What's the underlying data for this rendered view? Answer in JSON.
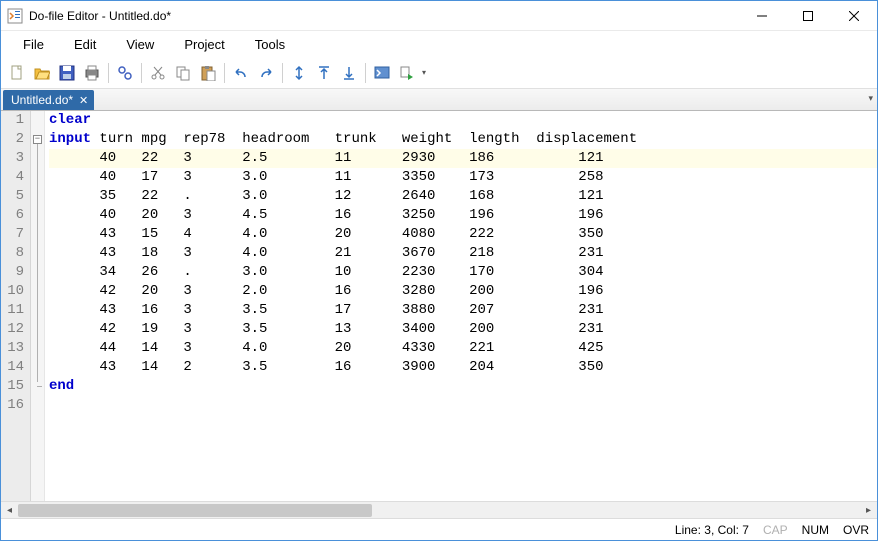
{
  "window": {
    "title": "Do-file Editor - Untitled.do*"
  },
  "menu": {
    "items": [
      "File",
      "Edit",
      "View",
      "Project",
      "Tools"
    ]
  },
  "toolbar": {
    "groups": [
      [
        "new-file",
        "open-file",
        "save",
        "print"
      ],
      [
        "find"
      ],
      [
        "cut",
        "copy",
        "paste"
      ],
      [
        "undo",
        "redo"
      ],
      [
        "indent-toggle",
        "outdent",
        "indent"
      ],
      [
        "run",
        "run-selection"
      ]
    ]
  },
  "tab": {
    "label": "Untitled.do*"
  },
  "code": {
    "keywords": {
      "clear": "clear",
      "input": "input",
      "end": "end"
    },
    "header": "turn mpg  rep78  headroom   trunk   weight  length  displacement",
    "highlight_line": 3,
    "rows": [
      {
        "turn": 40,
        "mpg": 22,
        "rep78": "3",
        "headroom": "2.5",
        "trunk": 11,
        "weight": 2930,
        "length": 186,
        "displacement": 121
      },
      {
        "turn": 40,
        "mpg": 17,
        "rep78": "3",
        "headroom": "3.0",
        "trunk": 11,
        "weight": 3350,
        "length": 173,
        "displacement": 258
      },
      {
        "turn": 35,
        "mpg": 22,
        "rep78": ".",
        "headroom": "3.0",
        "trunk": 12,
        "weight": 2640,
        "length": 168,
        "displacement": 121
      },
      {
        "turn": 40,
        "mpg": 20,
        "rep78": "3",
        "headroom": "4.5",
        "trunk": 16,
        "weight": 3250,
        "length": 196,
        "displacement": 196
      },
      {
        "turn": 43,
        "mpg": 15,
        "rep78": "4",
        "headroom": "4.0",
        "trunk": 20,
        "weight": 4080,
        "length": 222,
        "displacement": 350
      },
      {
        "turn": 43,
        "mpg": 18,
        "rep78": "3",
        "headroom": "4.0",
        "trunk": 21,
        "weight": 3670,
        "length": 218,
        "displacement": 231
      },
      {
        "turn": 34,
        "mpg": 26,
        "rep78": ".",
        "headroom": "3.0",
        "trunk": 10,
        "weight": 2230,
        "length": 170,
        "displacement": 304
      },
      {
        "turn": 42,
        "mpg": 20,
        "rep78": "3",
        "headroom": "2.0",
        "trunk": 16,
        "weight": 3280,
        "length": 200,
        "displacement": 196
      },
      {
        "turn": 43,
        "mpg": 16,
        "rep78": "3",
        "headroom": "3.5",
        "trunk": 17,
        "weight": 3880,
        "length": 207,
        "displacement": 231
      },
      {
        "turn": 42,
        "mpg": 19,
        "rep78": "3",
        "headroom": "3.5",
        "trunk": 13,
        "weight": 3400,
        "length": 200,
        "displacement": 231
      },
      {
        "turn": 44,
        "mpg": 14,
        "rep78": "3",
        "headroom": "4.0",
        "trunk": 20,
        "weight": 4330,
        "length": 221,
        "displacement": 425
      },
      {
        "turn": 43,
        "mpg": 14,
        "rep78": "2",
        "headroom": "3.5",
        "trunk": 16,
        "weight": 3900,
        "length": 204,
        "displacement": 350
      }
    ],
    "total_lines": 16
  },
  "status": {
    "linecol": "Line: 3, Col: 7",
    "cap": "CAP",
    "num": "NUM",
    "ovr": "OVR"
  }
}
